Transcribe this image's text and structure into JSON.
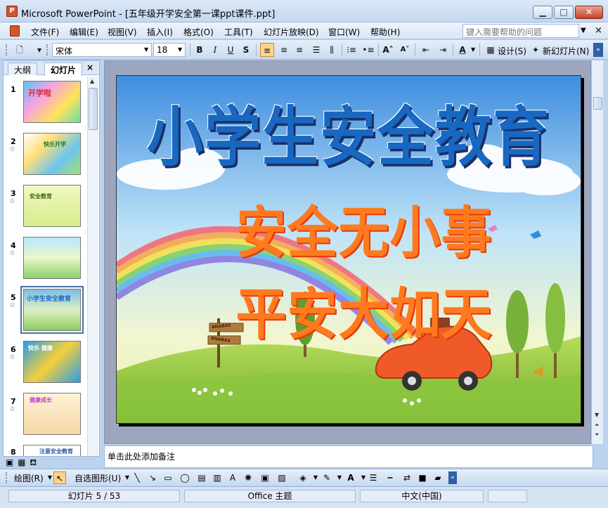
{
  "window": {
    "title": "Microsoft PowerPoint - [五年级开学安全第一课ppt课件.ppt]",
    "min_label": "▁",
    "max_label": "□",
    "close_label": "✕"
  },
  "menu": {
    "items": [
      "文件(F)",
      "编辑(E)",
      "视图(V)",
      "插入(I)",
      "格式(O)",
      "工具(T)",
      "幻灯片放映(D)",
      "窗口(W)",
      "帮助(H)"
    ],
    "help_placeholder": "键入需要帮助的问题",
    "close_label": "×"
  },
  "toolbar": {
    "font_name": "宋体",
    "font_size": "18",
    "bold": "B",
    "italic": "I",
    "underline": "U",
    "shadow": "S",
    "design_label": "设计(S)",
    "new_slide_label": "新幻灯片(N)"
  },
  "left_pane": {
    "tabs": [
      "大纲",
      "幻灯片"
    ],
    "close_label": "×",
    "slides": [
      {
        "number": "1",
        "star": "",
        "thumb_text": "开学啦"
      },
      {
        "number": "2",
        "star": "☆",
        "thumb_text": "快乐开学"
      },
      {
        "number": "3",
        "star": "☆",
        "thumb_text": "安全教育"
      },
      {
        "number": "4",
        "star": "☆",
        "thumb_text": ""
      },
      {
        "number": "5",
        "star": "☆",
        "thumb_text": "小学生安全教育"
      },
      {
        "number": "6",
        "star": "☆",
        "thumb_text": "快乐 健康"
      },
      {
        "number": "7",
        "star": "☆",
        "thumb_text": "健康成长"
      },
      {
        "number": "8",
        "star": "",
        "thumb_text": "注意安全教育"
      }
    ],
    "selected_index": 4
  },
  "slide": {
    "title": "小学生安全教育",
    "line1": "安全无小事",
    "line2": "平安大如天",
    "sign_top": "ANABAS",
    "sign_bottom": "ANABAS"
  },
  "notes": {
    "placeholder": "单击此处添加备注"
  },
  "draw_toolbar": {
    "draw_label": "绘图(R)",
    "autoshapes_label": "自选图形(U)"
  },
  "status": {
    "slide_position": "幻灯片 5 / 53",
    "theme": "Office 主题",
    "language": "中文(中国)"
  },
  "colors": {
    "title_blue": "#1868c2",
    "subtitle_orange": "#ff7a1e",
    "selection_blue": "#4a6fa5"
  }
}
